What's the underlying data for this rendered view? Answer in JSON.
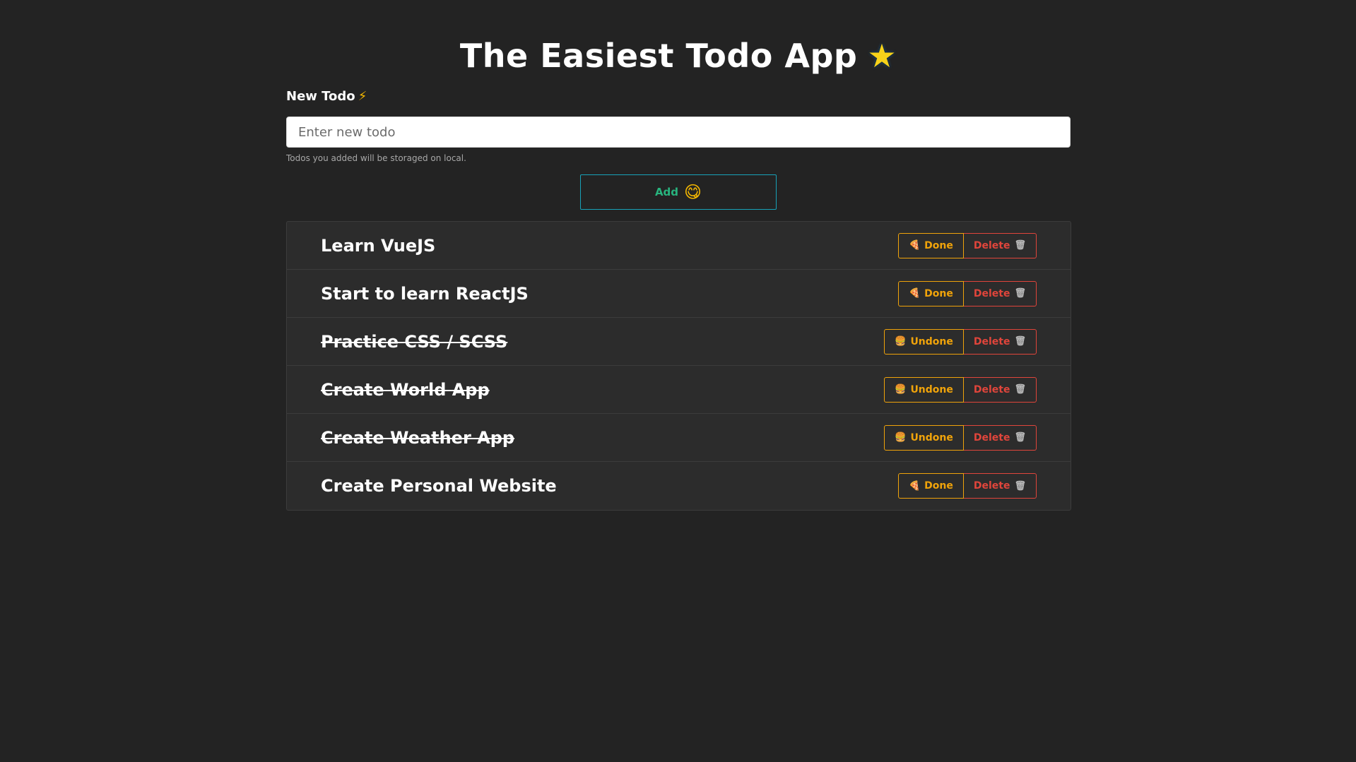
{
  "header": {
    "title": "The Easiest Todo App",
    "title_icon": "star-icon"
  },
  "form": {
    "label": "New Todo",
    "label_icon": "lightning-icon",
    "placeholder": "Enter new todo",
    "value": "",
    "hint": "Todos you added will be storaged on local.",
    "add_label": "Add",
    "add_icon": "smiling-face-icon"
  },
  "actions": {
    "done_label": "Done",
    "undone_label": "Undone",
    "delete_label": "Delete",
    "done_icon": "pizza-icon",
    "undone_icon": "burger-icon",
    "delete_icon": "trash-icon"
  },
  "todos": [
    {
      "title": "Learn VueJS",
      "done": false
    },
    {
      "title": "Start to learn ReactJS",
      "done": false
    },
    {
      "title": "Practice CSS / SCSS",
      "done": true
    },
    {
      "title": "Create World App",
      "done": true
    },
    {
      "title": "Create Weather App",
      "done": true
    },
    {
      "title": "Create Personal Website",
      "done": false
    }
  ],
  "colors": {
    "background": "#232323",
    "list_background": "#2c2c2c",
    "add_border": "#17a2b8",
    "add_text": "#28b47e",
    "toggle": "#f0a30a",
    "delete": "#e0453b"
  }
}
